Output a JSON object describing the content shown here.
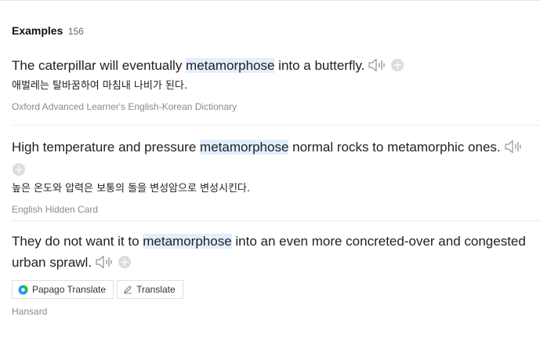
{
  "header": {
    "title": "Examples",
    "count": "156"
  },
  "examples": [
    {
      "before": "The caterpillar will eventually ",
      "highlight": "metamorphose",
      "after": " into a butterfly.",
      "translation": "애벌레는 탈바꿈하여 마침내 나비가 된다.",
      "source": "Oxford Advanced Learner's English-Korean Dictionary"
    },
    {
      "before": "High temperature and pressure ",
      "highlight": "metamorphose",
      "after": " normal rocks to metamorphic ones.",
      "translation": "높은 온도와 압력은 보통의 돌을 변성암으로 변성시킨다.",
      "source": "English Hidden Card"
    },
    {
      "before": "They do not want it to ",
      "highlight": "metamorphose",
      "after": " into an even more concreted-over and congested urban sprawl.",
      "source": "Hansard",
      "buttons": {
        "papago": "Papago Translate",
        "translate": "Translate"
      }
    }
  ],
  "icons": {
    "speaker": "speaker-icon",
    "add": "plus-circle-icon",
    "papago": "papago-logo-icon",
    "translate": "pen-icon"
  },
  "colors": {
    "highlight": "#e3efff",
    "papago_green": "#1ec800",
    "papago_blue": "#1a9cf0"
  }
}
